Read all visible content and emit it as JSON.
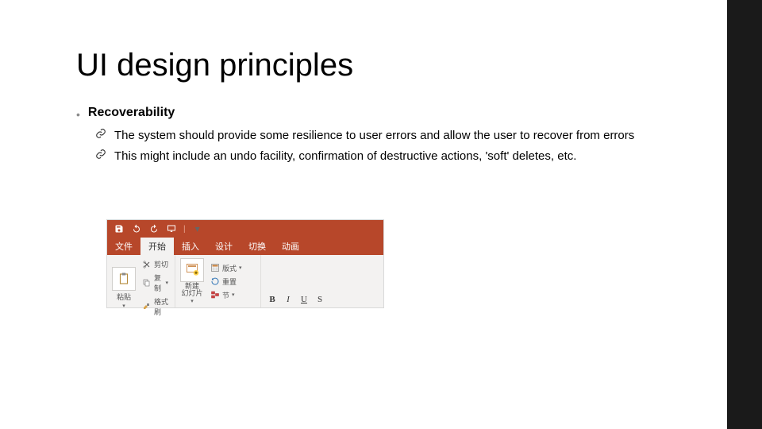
{
  "title": "UI design principles",
  "bullet": {
    "label": "Recoverability"
  },
  "sub": [
    "The system should provide some resilience to user errors and allow the user to recover from errors",
    "This might include an undo facility, confirmation of  destructive actions, 'soft' deletes, etc."
  ],
  "ribbon": {
    "tabs": [
      "文件",
      "开始",
      "插入",
      "设计",
      "切换",
      "动画"
    ],
    "active_tab_index": 1,
    "clipboard": {
      "paste": "粘贴",
      "cut": "剪切",
      "copy": "复制",
      "format_painter": "格式刷"
    },
    "slides": {
      "new_slide": "新建\n幻灯片",
      "layout": "版式",
      "reset": "重置",
      "section": "节"
    },
    "font": {
      "bold": "B",
      "italic": "I",
      "underline": "U",
      "shadow": "S"
    }
  }
}
